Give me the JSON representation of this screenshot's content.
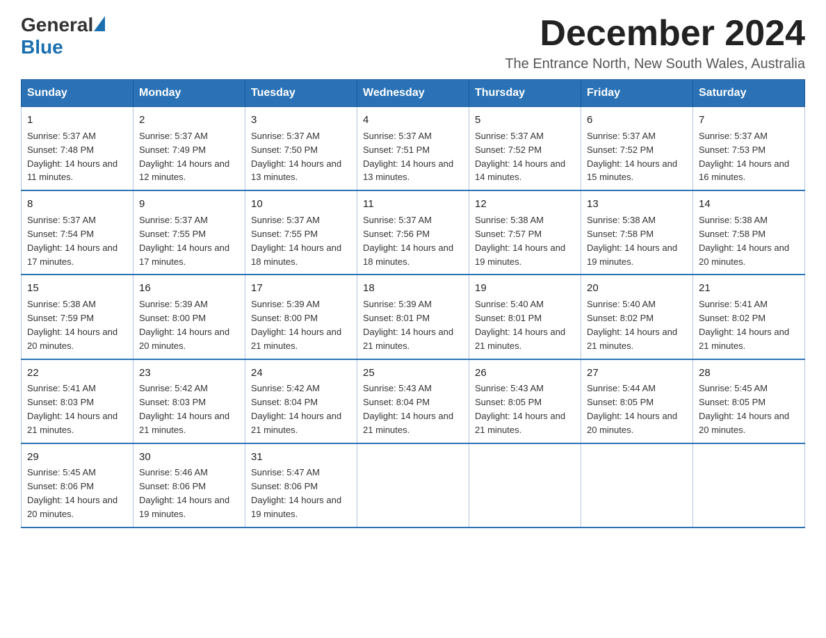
{
  "logo": {
    "general": "General",
    "blue": "Blue"
  },
  "title": "December 2024",
  "location": "The Entrance North, New South Wales, Australia",
  "days_of_week": [
    "Sunday",
    "Monday",
    "Tuesday",
    "Wednesday",
    "Thursday",
    "Friday",
    "Saturday"
  ],
  "weeks": [
    [
      {
        "day": "1",
        "sunrise": "5:37 AM",
        "sunset": "7:48 PM",
        "daylight": "14 hours and 11 minutes."
      },
      {
        "day": "2",
        "sunrise": "5:37 AM",
        "sunset": "7:49 PM",
        "daylight": "14 hours and 12 minutes."
      },
      {
        "day": "3",
        "sunrise": "5:37 AM",
        "sunset": "7:50 PM",
        "daylight": "14 hours and 13 minutes."
      },
      {
        "day": "4",
        "sunrise": "5:37 AM",
        "sunset": "7:51 PM",
        "daylight": "14 hours and 13 minutes."
      },
      {
        "day": "5",
        "sunrise": "5:37 AM",
        "sunset": "7:52 PM",
        "daylight": "14 hours and 14 minutes."
      },
      {
        "day": "6",
        "sunrise": "5:37 AM",
        "sunset": "7:52 PM",
        "daylight": "14 hours and 15 minutes."
      },
      {
        "day": "7",
        "sunrise": "5:37 AM",
        "sunset": "7:53 PM",
        "daylight": "14 hours and 16 minutes."
      }
    ],
    [
      {
        "day": "8",
        "sunrise": "5:37 AM",
        "sunset": "7:54 PM",
        "daylight": "14 hours and 17 minutes."
      },
      {
        "day": "9",
        "sunrise": "5:37 AM",
        "sunset": "7:55 PM",
        "daylight": "14 hours and 17 minutes."
      },
      {
        "day": "10",
        "sunrise": "5:37 AM",
        "sunset": "7:55 PM",
        "daylight": "14 hours and 18 minutes."
      },
      {
        "day": "11",
        "sunrise": "5:37 AM",
        "sunset": "7:56 PM",
        "daylight": "14 hours and 18 minutes."
      },
      {
        "day": "12",
        "sunrise": "5:38 AM",
        "sunset": "7:57 PM",
        "daylight": "14 hours and 19 minutes."
      },
      {
        "day": "13",
        "sunrise": "5:38 AM",
        "sunset": "7:58 PM",
        "daylight": "14 hours and 19 minutes."
      },
      {
        "day": "14",
        "sunrise": "5:38 AM",
        "sunset": "7:58 PM",
        "daylight": "14 hours and 20 minutes."
      }
    ],
    [
      {
        "day": "15",
        "sunrise": "5:38 AM",
        "sunset": "7:59 PM",
        "daylight": "14 hours and 20 minutes."
      },
      {
        "day": "16",
        "sunrise": "5:39 AM",
        "sunset": "8:00 PM",
        "daylight": "14 hours and 20 minutes."
      },
      {
        "day": "17",
        "sunrise": "5:39 AM",
        "sunset": "8:00 PM",
        "daylight": "14 hours and 21 minutes."
      },
      {
        "day": "18",
        "sunrise": "5:39 AM",
        "sunset": "8:01 PM",
        "daylight": "14 hours and 21 minutes."
      },
      {
        "day": "19",
        "sunrise": "5:40 AM",
        "sunset": "8:01 PM",
        "daylight": "14 hours and 21 minutes."
      },
      {
        "day": "20",
        "sunrise": "5:40 AM",
        "sunset": "8:02 PM",
        "daylight": "14 hours and 21 minutes."
      },
      {
        "day": "21",
        "sunrise": "5:41 AM",
        "sunset": "8:02 PM",
        "daylight": "14 hours and 21 minutes."
      }
    ],
    [
      {
        "day": "22",
        "sunrise": "5:41 AM",
        "sunset": "8:03 PM",
        "daylight": "14 hours and 21 minutes."
      },
      {
        "day": "23",
        "sunrise": "5:42 AM",
        "sunset": "8:03 PM",
        "daylight": "14 hours and 21 minutes."
      },
      {
        "day": "24",
        "sunrise": "5:42 AM",
        "sunset": "8:04 PM",
        "daylight": "14 hours and 21 minutes."
      },
      {
        "day": "25",
        "sunrise": "5:43 AM",
        "sunset": "8:04 PM",
        "daylight": "14 hours and 21 minutes."
      },
      {
        "day": "26",
        "sunrise": "5:43 AM",
        "sunset": "8:05 PM",
        "daylight": "14 hours and 21 minutes."
      },
      {
        "day": "27",
        "sunrise": "5:44 AM",
        "sunset": "8:05 PM",
        "daylight": "14 hours and 20 minutes."
      },
      {
        "day": "28",
        "sunrise": "5:45 AM",
        "sunset": "8:05 PM",
        "daylight": "14 hours and 20 minutes."
      }
    ],
    [
      {
        "day": "29",
        "sunrise": "5:45 AM",
        "sunset": "8:06 PM",
        "daylight": "14 hours and 20 minutes."
      },
      {
        "day": "30",
        "sunrise": "5:46 AM",
        "sunset": "8:06 PM",
        "daylight": "14 hours and 19 minutes."
      },
      {
        "day": "31",
        "sunrise": "5:47 AM",
        "sunset": "8:06 PM",
        "daylight": "14 hours and 19 minutes."
      },
      null,
      null,
      null,
      null
    ]
  ]
}
